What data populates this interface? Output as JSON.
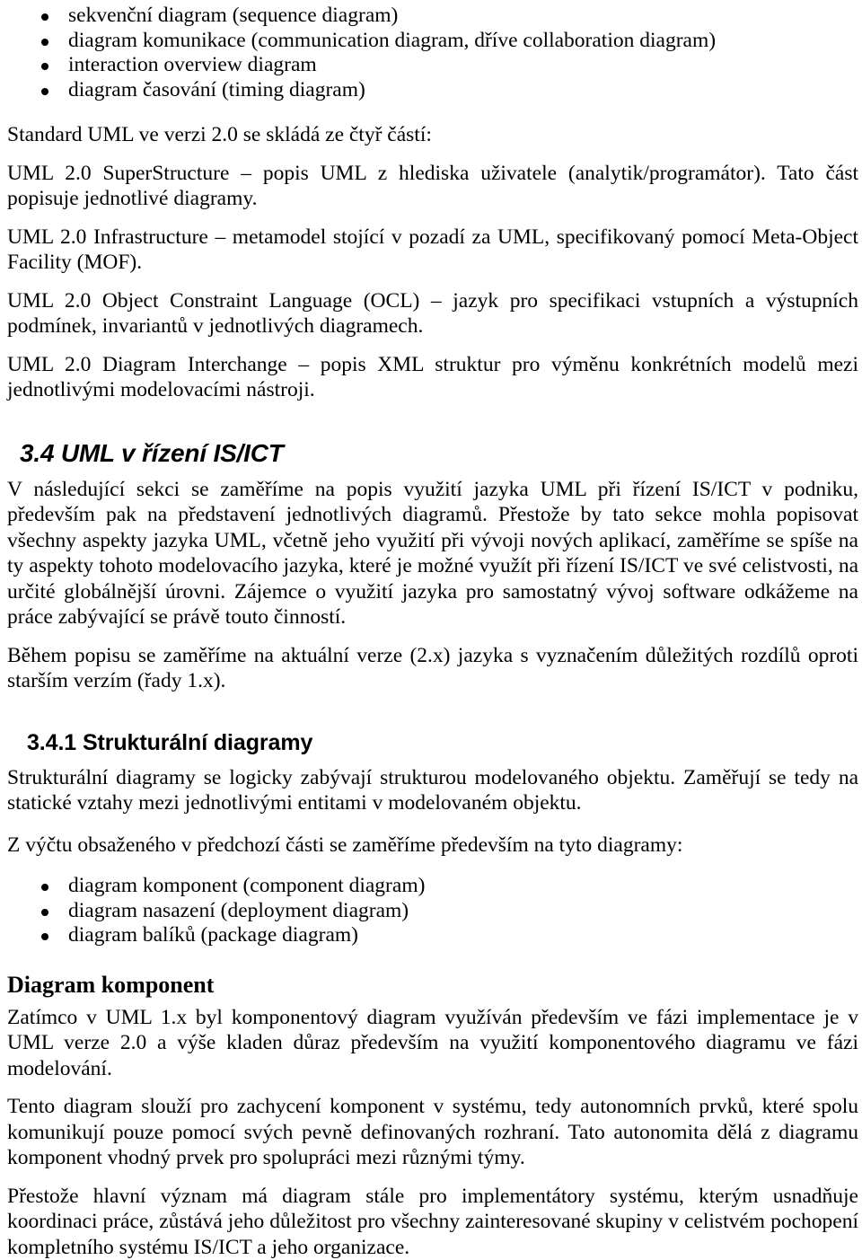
{
  "document": {
    "language": "cs",
    "top_list": {
      "items": [
        "sekvenční diagram (sequence diagram)",
        "diagram komunikace (communication diagram, dříve collaboration diagram)",
        "interaction overview diagram",
        "diagram časování (timing diagram)"
      ]
    },
    "intro": {
      "lead": "Standard UML ve verzi 2.0 se skládá ze čtyř částí:",
      "parts": [
        "UML 2.0 SuperStructure – popis UML z hlediska uživatele (analytik/programátor). Tato část popisuje jednotlivé diagramy.",
        "UML 2.0 Infrastructure – metamodel stojící v pozadí za UML, specifikovaný pomocí Meta-Object Facility (MOF).",
        "UML 2.0 Object Constraint Language (OCL) – jazyk pro specifikaci vstupních a výstupních podmínek, invariantů v jednotlivých diagramech.",
        "UML 2.0 Diagram Interchange – popis XML struktur pro výměnu konkrétních modelů mezi jednotlivými modelovacími nástroji."
      ]
    },
    "section_34": {
      "heading": "3.4 UML v řízení IS/ICT",
      "paragraphs": [
        "V následující sekci se zaměříme na popis využití jazyka UML při řízení IS/ICT v podniku, především pak na představení jednotlivých diagramů. Přestože by tato sekce mohla popisovat všechny aspekty jazyka UML, včetně jeho využití při vývoji nových aplikací, zaměříme se spíše na ty aspekty tohoto modelovacího jazyka, které je možné využít při řízení IS/ICT ve své celistvosti, na určité globálnější úrovni. Zájemce o využití jazyka pro samostatný vývoj software odkážeme na práce zabývající se právě touto činností.",
        "Během popisu se zaměříme na aktuální verze (2.x) jazyka s vyznačením důležitých rozdílů oproti starším verzím (řady 1.x)."
      ]
    },
    "section_341": {
      "heading": "3.4.1 Strukturální diagramy",
      "paragraphs": [
        "Strukturální diagramy se logicky zabývají strukturou modelovaného objektu. Zaměřují se tedy na statické vztahy mezi jednotlivými entitami v modelovaném objektu.",
        "Z výčtu obsaženého v předchozí části se zaměříme především na tyto diagramy:"
      ],
      "list": {
        "items": [
          "diagram komponent (component diagram)",
          "diagram nasazení (deployment diagram)",
          "diagram balíků (package diagram)"
        ]
      }
    },
    "subsection_component": {
      "heading": "Diagram komponent",
      "paragraphs": [
        "Zatímco v UML 1.x byl komponentový diagram využíván především ve fázi implementace je v UML verze 2.0 a výše kladen důraz především na využití komponentového diagramu ve fázi modelování.",
        "Tento diagram slouží pro zachycení komponent v systému, tedy autonomních prvků, které spolu komunikují pouze pomocí svých pevně definovaných rozhraní. Tato autonomita dělá z diagramu komponent vhodný prvek pro spolupráci mezi různými týmy.",
        "Přestože hlavní význam má diagram stále pro implementátory systému, kterým usnadňuje koordinaci práce, zůstává jeho důležitost pro všechny zainteresované skupiny v celistvém pochopení kompletního systému IS/ICT a jeho organizace."
      ]
    }
  }
}
